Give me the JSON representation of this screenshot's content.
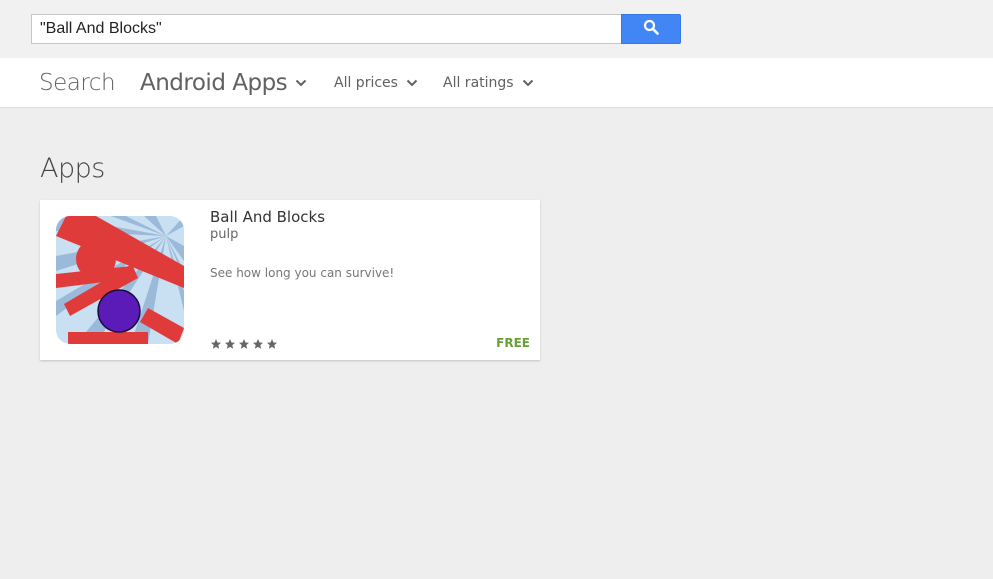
{
  "search": {
    "query": "\"Ball And Blocks\"",
    "button_icon": "search-icon"
  },
  "nav": {
    "search_label": "Search",
    "category_label": "Android Apps",
    "price_filter_label": "All prices",
    "rating_filter_label": "All ratings"
  },
  "section": {
    "title": "Apps"
  },
  "results": [
    {
      "title": "Ball And Blocks",
      "developer": "pulp",
      "description": "See how long you can survive!",
      "rating_stars": 5,
      "price": "FREE"
    }
  ],
  "colors": {
    "accent": "#4285f4",
    "price": "#689f38",
    "background": "#eeeeee"
  }
}
